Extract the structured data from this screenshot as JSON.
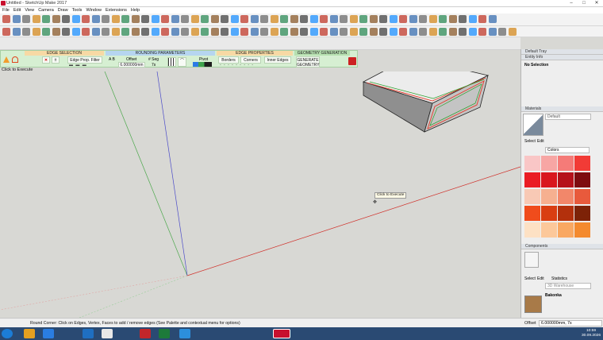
{
  "window": {
    "title": "Untitled - SketchUp Make 2017"
  },
  "menu": [
    "File",
    "Edit",
    "View",
    "Camera",
    "Draw",
    "Tools",
    "Window",
    "Extensions",
    "Help"
  ],
  "extension_panel": {
    "sections": [
      "EDGE SELECTION",
      "ROUNDING PARAMETERS",
      "EDGE PROPERTIES",
      "GEOMETRY GENERATION"
    ],
    "edge_prop_filter_label": "Edge Prop. Filter",
    "ab_label": "A  B",
    "offset_label": "Offset",
    "offset_value": "6.000000mm",
    "seg_label": "# Seg",
    "seg_value": "7s",
    "pivot_label": "Pivot",
    "borders_label": "Borders",
    "corners_label": "Corners",
    "inner_edges_label": "Inner Edges",
    "generate_label": "GENERATE GEOMETRY",
    "click_to_execute": "Click to Execute"
  },
  "tray": {
    "title": "Default Tray",
    "entity_info_title": "Entity Info",
    "entity_info_status": "No Selection",
    "materials_title": "Materials",
    "material_name": "Default",
    "tabs_select": "Select",
    "tabs_edit": "Edit",
    "colors_dropdown": "Colors",
    "components_title": "Components",
    "comp_tabs": [
      "Select",
      "Edit",
      "Statistics"
    ],
    "warehouse_placeholder": "3D Warehouse",
    "component_name": "Bakonka"
  },
  "swatches": [
    "#f9c6c6",
    "#f7a6a4",
    "#f57b78",
    "#f23b36",
    "#ea1c24",
    "#d9171f",
    "#b5121b",
    "#7e0c10",
    "#f8c9b5",
    "#f6b090",
    "#f2876a",
    "#e85a3c",
    "#f04c1c",
    "#d93e12",
    "#b3300c",
    "#7d2207",
    "#fde1c4",
    "#fcc89a",
    "#f9a862",
    "#f48a2e"
  ],
  "viewport_tooltip": "Click to Execute",
  "status": {
    "message": "Round Corner: Click on Edges, Vertex, Faces to add / remove edges (See Palette and contextual menu for options)",
    "measure_label": "Offset",
    "measure_value": "6.000000mm, 7s"
  },
  "clock": {
    "time": "10:59",
    "date": "30.09.2026"
  }
}
